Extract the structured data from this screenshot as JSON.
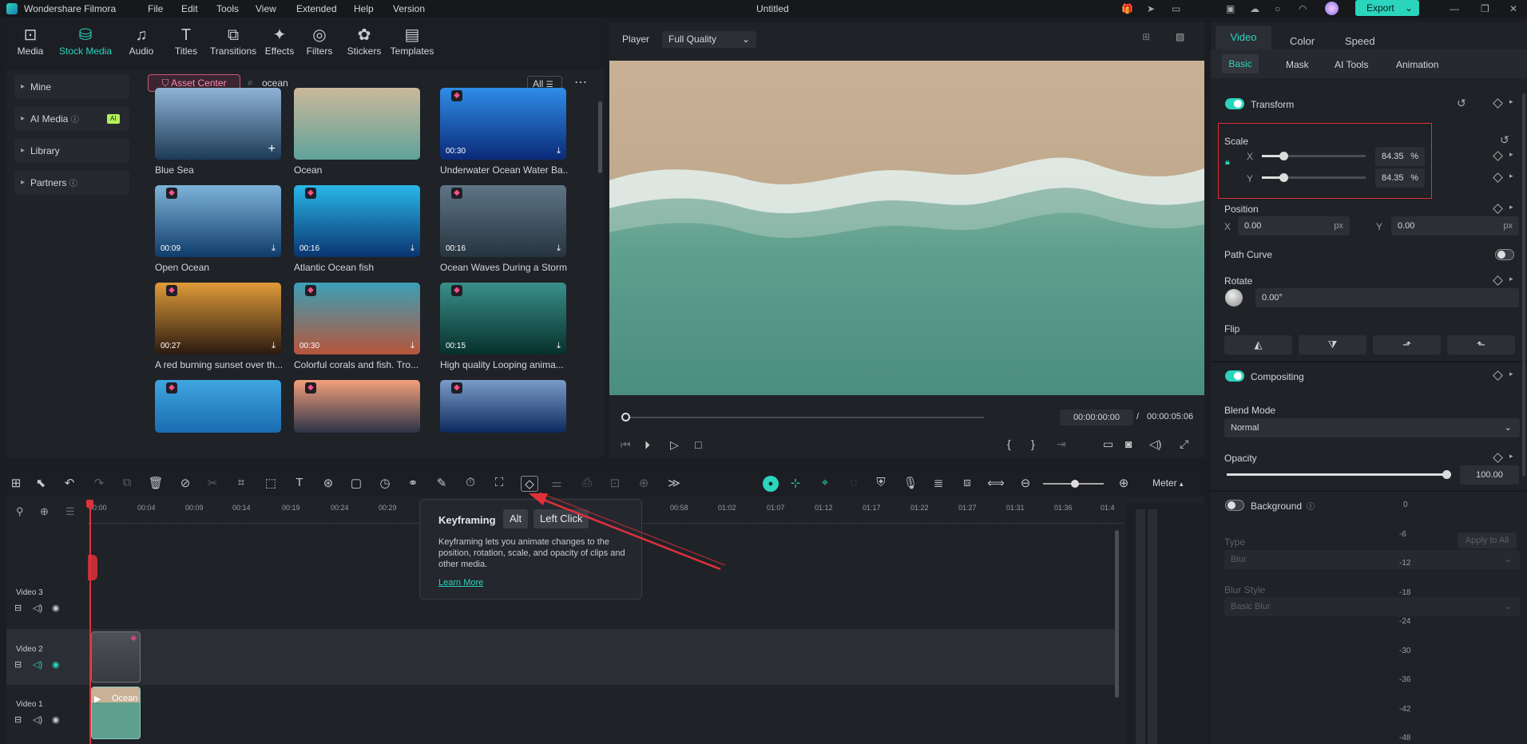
{
  "app": {
    "name": "Wondershare Filmora",
    "doc_title": "Untitled",
    "export_label": "Export"
  },
  "menu": [
    "File",
    "Edit",
    "Tools",
    "View",
    "Extended",
    "Help",
    "Version"
  ],
  "toolbar": [
    "Media",
    "Stock Media",
    "Audio",
    "Titles",
    "Transitions",
    "Effects",
    "Filters",
    "Stickers",
    "Templates"
  ],
  "sidebar": [
    "Mine",
    "AI Media",
    "Library",
    "Partners"
  ],
  "ai_badge": "AI",
  "asset_center": "Asset Center",
  "search": {
    "value": "ocean",
    "filter": "All"
  },
  "assets": [
    {
      "title": "Blue Sea",
      "dur": "",
      "c1": "#8fb3d6",
      "c2": "#1c3a56"
    },
    {
      "title": "Ocean",
      "dur": "",
      "c1": "#cbb89a",
      "c2": "#5fa39a"
    },
    {
      "title": "Underwater Ocean Water Ba...",
      "dur": "00:30",
      "c1": "#2e8de8",
      "c2": "#0b2a78"
    },
    {
      "title": "Open Ocean",
      "dur": "00:09",
      "c1": "#7eb3d8",
      "c2": "#0f3c6a"
    },
    {
      "title": "Atlantic Ocean fish",
      "dur": "00:16",
      "c1": "#29b7e8",
      "c2": "#0a3470"
    },
    {
      "title": "Ocean Waves During a Storm",
      "dur": "00:16",
      "c1": "#5e7585",
      "c2": "#26343f"
    },
    {
      "title": "A red burning sunset over th...",
      "dur": "00:27",
      "c1": "#e09b3a",
      "c2": "#2a1a10"
    },
    {
      "title": "Colorful corals and fish. Tro...",
      "dur": "00:30",
      "c1": "#3aa0b8",
      "c2": "#b8553a"
    },
    {
      "title": "High quality Looping anima...",
      "dur": "00:15",
      "c1": "#3a8f8a",
      "c2": "#06302c"
    },
    {
      "title": "",
      "dur": "",
      "c1": "#3fa6e0",
      "c2": "#1a6cb0"
    },
    {
      "title": "",
      "dur": "",
      "c1": "#f2a07a",
      "c2": "#2c3248"
    },
    {
      "title": "",
      "dur": "",
      "c1": "#7a9cc8",
      "c2": "#0d2a5e"
    }
  ],
  "player": {
    "label": "Player",
    "quality": "Full Quality",
    "time_current": "00:00:00:00",
    "time_sep": "/",
    "time_total": "00:00:05:06"
  },
  "right": {
    "tabs": [
      "Video",
      "Color",
      "Speed"
    ],
    "subtabs": [
      "Basic",
      "Mask",
      "AI Tools",
      "Animation"
    ],
    "transform": "Transform",
    "scale": "Scale",
    "x": "X",
    "y": "Y",
    "scale_x": "84.35",
    "scale_y": "84.35",
    "pct": "%",
    "position": "Position",
    "pos_x": "0.00",
    "pos_y": "0.00",
    "px": "px",
    "path_curve": "Path Curve",
    "rotate": "Rotate",
    "rotate_val": "0.00°",
    "flip": "Flip",
    "compositing": "Compositing",
    "blend_mode": "Blend Mode",
    "blend_val": "Normal",
    "opacity": "Opacity",
    "opacity_val": "100.00",
    "background": "Background",
    "type": "Type",
    "apply_all": "Apply to All",
    "type_val": "Blur",
    "blur_style": "Blur Style",
    "blur_style_val": "Basic Blur"
  },
  "timeline": {
    "meter": "Meter",
    "ruler": [
      "00:00",
      "00:04",
      "00:09",
      "00:14",
      "00:19",
      "00:24",
      "00:29",
      "00:58",
      "01:02",
      "01:07",
      "01:12",
      "01:17",
      "01:22",
      "01:27",
      "01:31",
      "01:36",
      "01:4"
    ],
    "tracks": [
      "Video 3",
      "Video 2",
      "Video 1"
    ],
    "clip_label": "Ocean",
    "meter_levels": [
      "0",
      "-6",
      "-12",
      "-18",
      "-24",
      "-30",
      "-36",
      "-42",
      "-48"
    ]
  },
  "tooltip": {
    "title": "Keyframing",
    "key1": "Alt",
    "key2": "Left Click",
    "body": "Keyframing lets you animate changes to the position, rotation, scale, and opacity of clips and other media.",
    "link": "Learn More"
  },
  "colors": {
    "accent": "#2bd4bd",
    "highlight": "#e0313b",
    "arrow": "#e0313b"
  }
}
